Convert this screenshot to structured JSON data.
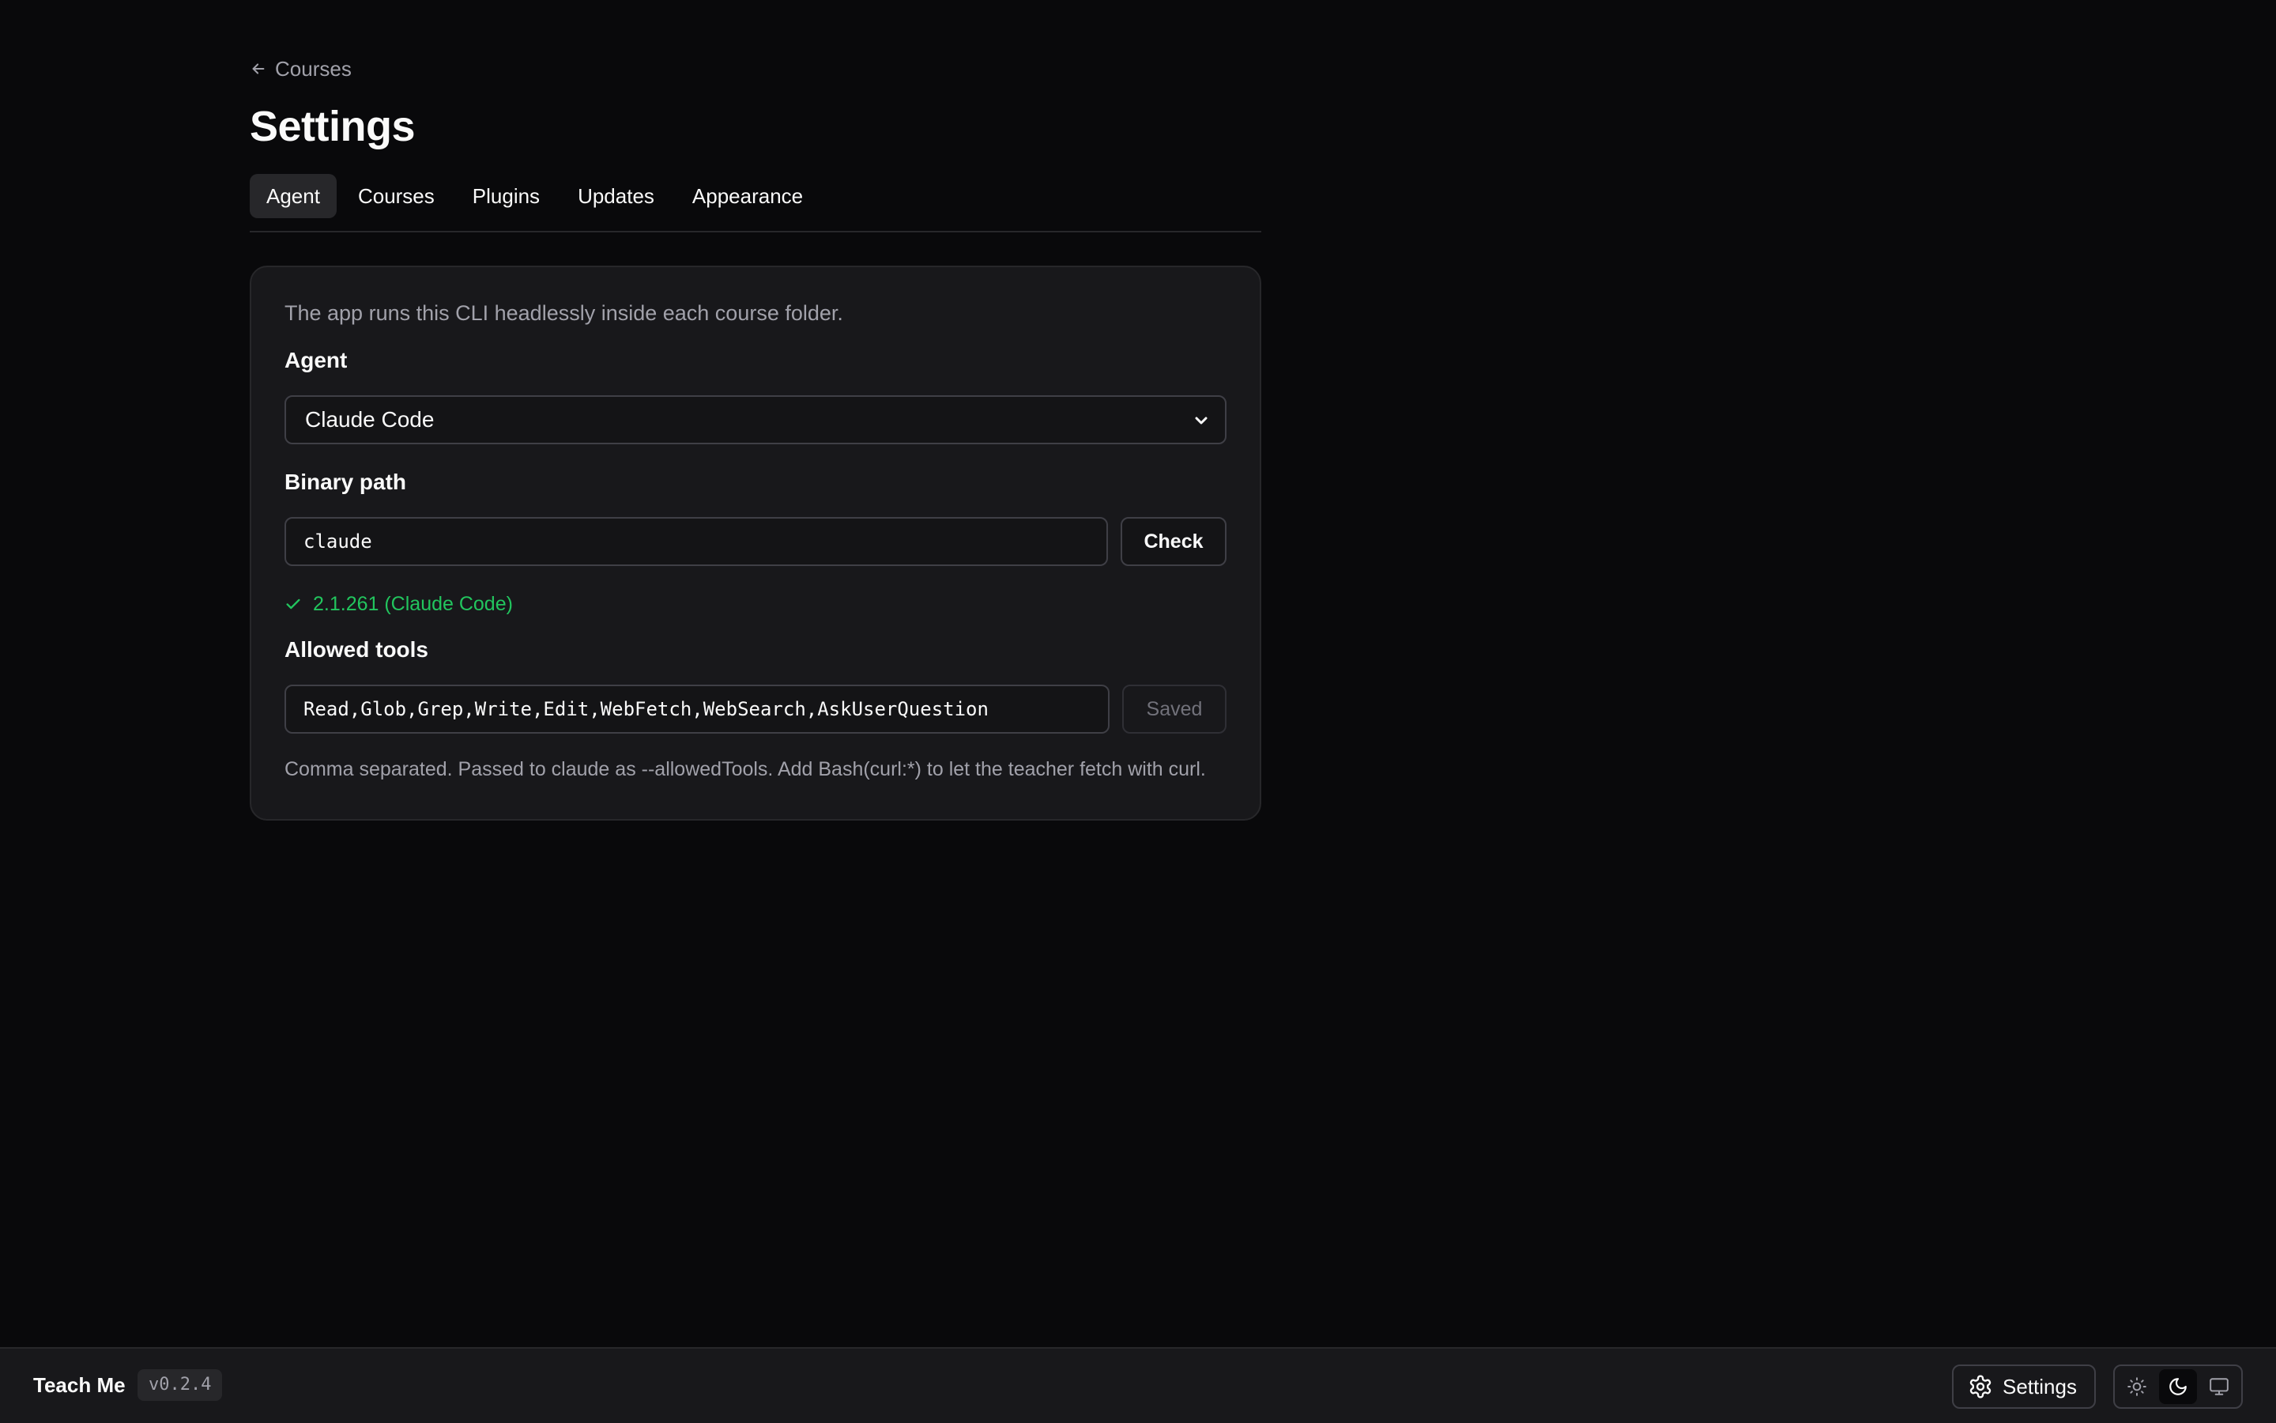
{
  "header": {
    "back_label": "Courses",
    "title": "Settings"
  },
  "tabs": [
    {
      "label": "Agent",
      "active": true
    },
    {
      "label": "Courses",
      "active": false
    },
    {
      "label": "Plugins",
      "active": false
    },
    {
      "label": "Updates",
      "active": false
    },
    {
      "label": "Appearance",
      "active": false
    }
  ],
  "agent_card": {
    "description": "The app runs this CLI headlessly inside each course folder.",
    "agent_label": "Agent",
    "agent_selected": "Claude Code",
    "binary_label": "Binary path",
    "binary_value": "claude",
    "check_label": "Check",
    "status_text": "2.1.261 (Claude Code)",
    "tools_label": "Allowed tools",
    "tools_value": "Read,Glob,Grep,Write,Edit,WebFetch,WebSearch,AskUserQuestion",
    "saved_label": "Saved",
    "hint": "Comma separated. Passed to claude as --allowedTools. Add Bash(curl:*) to let the teacher fetch with curl."
  },
  "footer": {
    "app_name": "Teach Me",
    "version": "v0.2.4",
    "settings_label": "Settings",
    "theme_modes": [
      "light",
      "dark",
      "system"
    ],
    "theme_active": "dark"
  },
  "colors": {
    "background": "#09090b",
    "card": "#18181b",
    "success": "#22c55e",
    "muted_text": "#a1a1aa"
  }
}
